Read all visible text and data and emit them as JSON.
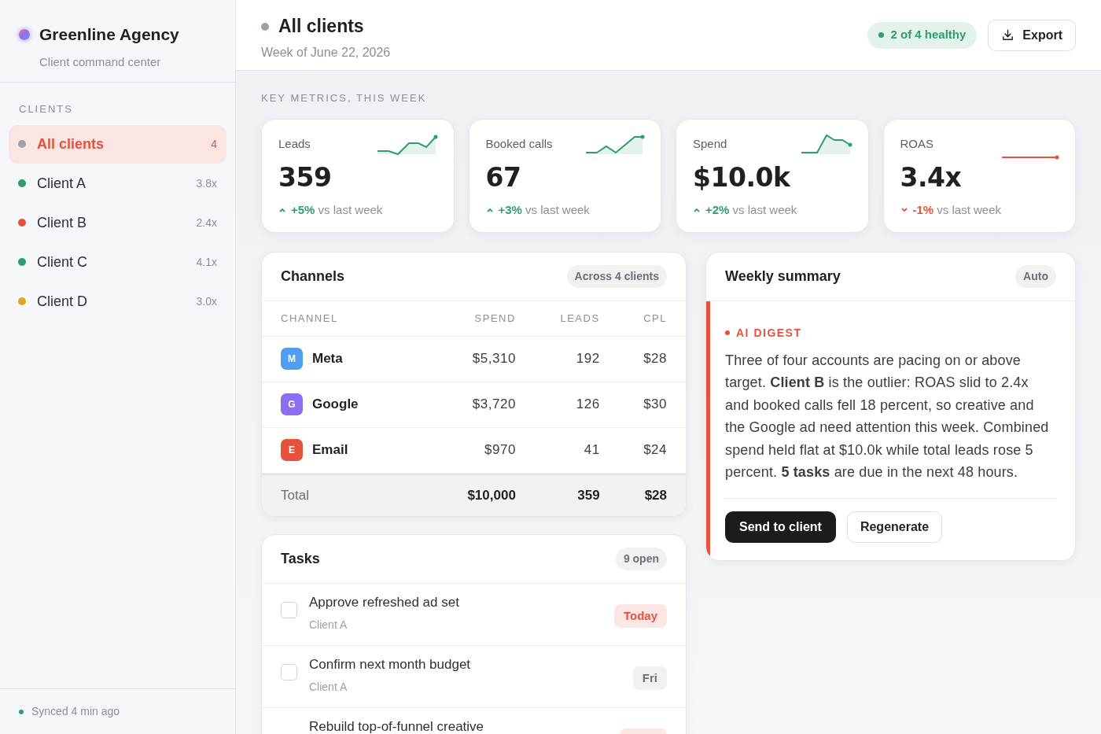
{
  "sidebar": {
    "brand": "Greenline Agency",
    "tagline": "Client command center",
    "section_label": "CLIENTS",
    "items": [
      {
        "label": "All clients",
        "meta": "4",
        "color": "#9ca3af",
        "selected": true
      },
      {
        "label": "Client A",
        "meta": "3.8x",
        "color": "#2f9e6b",
        "selected": false
      },
      {
        "label": "Client B",
        "meta": "2.4x",
        "color": "#e5533d",
        "selected": false
      },
      {
        "label": "Client C",
        "meta": "4.1x",
        "color": "#2f9e6b",
        "selected": false
      },
      {
        "label": "Client D",
        "meta": "3.0x",
        "color": "#e0a526",
        "selected": false
      }
    ],
    "sync_status": "Synced 4 min ago"
  },
  "header": {
    "title": "All clients",
    "subtitle": "Week of June 22, 2026",
    "health_badge": "2 of 4 healthy",
    "export_button": "Export"
  },
  "metrics_label": "KEY METRICS, THIS WEEK",
  "metrics": [
    {
      "label": "Leads",
      "value": "359",
      "rising": true,
      "change": "+5%",
      "comparison": "vs last week"
    },
    {
      "label": "Booked calls",
      "value": "67",
      "rising": true,
      "change": "+3%",
      "comparison": "vs last week"
    },
    {
      "label": "Spend",
      "value": "$10.0k",
      "rising": true,
      "change": "+2%",
      "comparison": "vs last week"
    },
    {
      "label": "ROAS",
      "value": "3.4x",
      "rising": false,
      "change": "-1%",
      "comparison": "vs last week"
    }
  ],
  "channels": {
    "title": "Channels",
    "badge": "Across 4 clients",
    "columns": [
      "CHANNEL",
      "SPEND",
      "LEADS",
      "CPL"
    ],
    "rows": [
      {
        "letter": "M",
        "color": "#4f9ef0",
        "name": "Meta",
        "spend": "$5,310",
        "leads": "192",
        "cpl": "$28"
      },
      {
        "letter": "G",
        "color": "#8b6ff0",
        "name": "Google",
        "spend": "$3,720",
        "leads": "126",
        "cpl": "$30"
      },
      {
        "letter": "E",
        "color": "#e5533d",
        "name": "Email",
        "spend": "$970",
        "leads": "41",
        "cpl": "$24"
      }
    ],
    "total": {
      "label": "Total",
      "spend": "$10,000",
      "leads": "359",
      "cpl": "$28"
    }
  },
  "tasks": {
    "title": "Tasks",
    "badge": "9 open",
    "items": [
      {
        "title": "Approve refreshed ad set",
        "client": "Client A",
        "due": "Today",
        "urgent": true,
        "checked": false
      },
      {
        "title": "Confirm next month budget",
        "client": "Client A",
        "due": "Fri",
        "urgent": false,
        "checked": false
      },
      {
        "title": "Rebuild top-of-funnel creative",
        "urgent": true
      }
    ]
  },
  "summary": {
    "title": "Weekly summary",
    "badge": "Auto",
    "digest_label": "AI DIGEST",
    "text": "Three of four accounts are pacing on or above target. **Client B** is the outlier: ROAS slid to 2.4x and booked calls fell 18 percent, so creative and the Google ad need attention this week. Combined spend held flat at $10.0k while total leads rose 5 percent. **5 tasks** are due in the next 48 hours.",
    "primary_button": "Send to client",
    "secondary_button": "Regenerate"
  }
}
